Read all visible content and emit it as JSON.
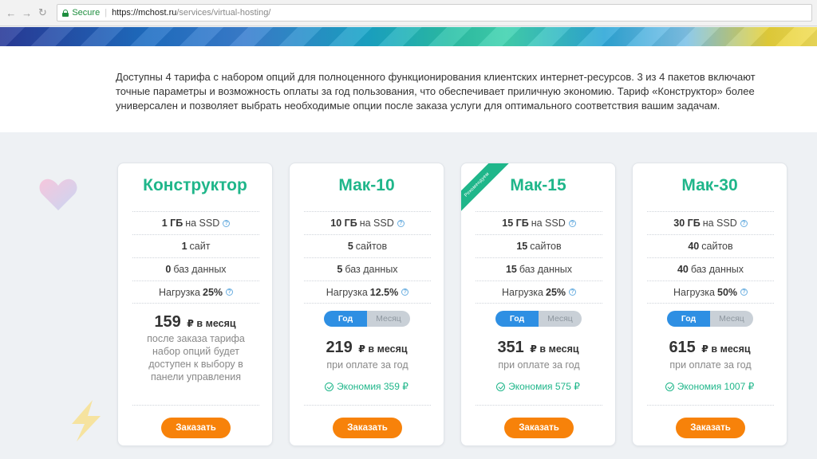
{
  "browser": {
    "secure_label": "Secure",
    "url_host": "https://mchost.ru",
    "url_path": "/services/virtual-hosting/"
  },
  "intro": {
    "text": "Доступны 4 тарифа с набором опций для полноценного функционирования клиентских интернет-ресурсов. 3 из 4 пакетов включают точные параметры и возможность оплаты за год пользования, что обеспечивает приличную экономию. Тариф «Конструктор» более универсален и позволяет выбрать необходимые опции после заказа услуги для оптимального соответствия вашим задачам."
  },
  "colors": {
    "accent_green": "#1fb68a",
    "toggle_blue": "#2e8fe3",
    "order_orange": "#f7820a"
  },
  "plans": [
    {
      "title": "Конструктор",
      "disk_value": "1 ГБ",
      "disk_suffix": "на SSD",
      "sites_value": "1",
      "sites_suffix": "сайт",
      "db_value": "0",
      "db_suffix": "баз данных",
      "load_prefix": "Нагрузка",
      "load_value": "25%",
      "price": "159",
      "price_unit": "₽ в месяц",
      "price_note": "после заказа тарифа набор опций будет доступен к выбору в панели управления",
      "order_label": "Заказать"
    },
    {
      "title": "Мак-10",
      "disk_value": "10 ГБ",
      "disk_suffix": "на SSD",
      "sites_value": "5",
      "sites_suffix": "сайтов",
      "db_value": "5",
      "db_suffix": "баз данных",
      "load_prefix": "Нагрузка",
      "load_value": "12.5%",
      "toggle_year": "Год",
      "toggle_month": "Месяц",
      "price": "219",
      "price_unit": "₽ в месяц",
      "price_note": "при оплате за год",
      "saving": "Экономия 359 ₽",
      "order_label": "Заказать"
    },
    {
      "title": "Мак-15",
      "ribbon": "Рекомендуем",
      "disk_value": "15 ГБ",
      "disk_suffix": "на SSD",
      "sites_value": "15",
      "sites_suffix": "сайтов",
      "db_value": "15",
      "db_suffix": "баз данных",
      "load_prefix": "Нагрузка",
      "load_value": "25%",
      "toggle_year": "Год",
      "toggle_month": "Месяц",
      "price": "351",
      "price_unit": "₽ в месяц",
      "price_note": "при оплате за год",
      "saving": "Экономия 575 ₽",
      "order_label": "Заказать"
    },
    {
      "title": "Мак-30",
      "disk_value": "30 ГБ",
      "disk_suffix": "на SSD",
      "sites_value": "40",
      "sites_suffix": "сайтов",
      "db_value": "40",
      "db_suffix": "баз данных",
      "load_prefix": "Нагрузка",
      "load_value": "50%",
      "toggle_year": "Год",
      "toggle_month": "Месяц",
      "price": "615",
      "price_unit": "₽ в месяц",
      "price_note": "при оплате за год",
      "saving": "Экономия 1007 ₽",
      "order_label": "Заказать"
    }
  ]
}
